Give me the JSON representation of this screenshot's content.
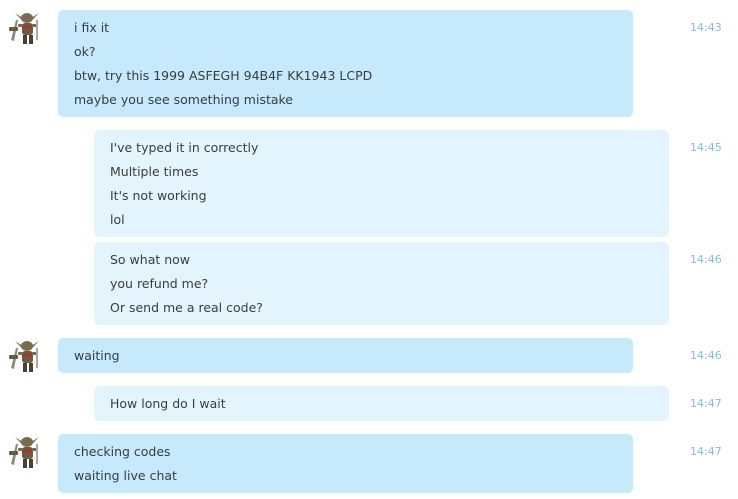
{
  "colors": {
    "incoming_bubble": "#c6e9fb",
    "outgoing_bubble": "#e4f4fd",
    "timestamp": "#8eb8d0",
    "text": "#3c3c3c"
  },
  "messages": [
    {
      "direction": "incoming",
      "avatar": "goblin-warrior-avatar",
      "time": "14:43",
      "lines": [
        "i fix it",
        "ok?",
        "btw, try this 1999 ASFEGH 94B4F KK1943 LCPD",
        "maybe you see something mistake"
      ]
    },
    {
      "direction": "outgoing",
      "time": "14:45",
      "lines": [
        "I've typed it in correctly",
        "Multiple times",
        "It's not working",
        "lol"
      ]
    },
    {
      "direction": "outgoing",
      "time": "14:46",
      "lines": [
        "So what now",
        "you refund me?",
        "Or send me a real code?"
      ]
    },
    {
      "direction": "incoming",
      "avatar": "goblin-warrior-avatar",
      "time": "14:46",
      "lines": [
        "waiting"
      ]
    },
    {
      "direction": "outgoing",
      "time": "14:47",
      "lines": [
        "How long do I wait"
      ]
    },
    {
      "direction": "incoming",
      "avatar": "goblin-warrior-avatar",
      "time": "14:47",
      "lines": [
        "checking codes",
        "waiting live chat"
      ]
    }
  ]
}
